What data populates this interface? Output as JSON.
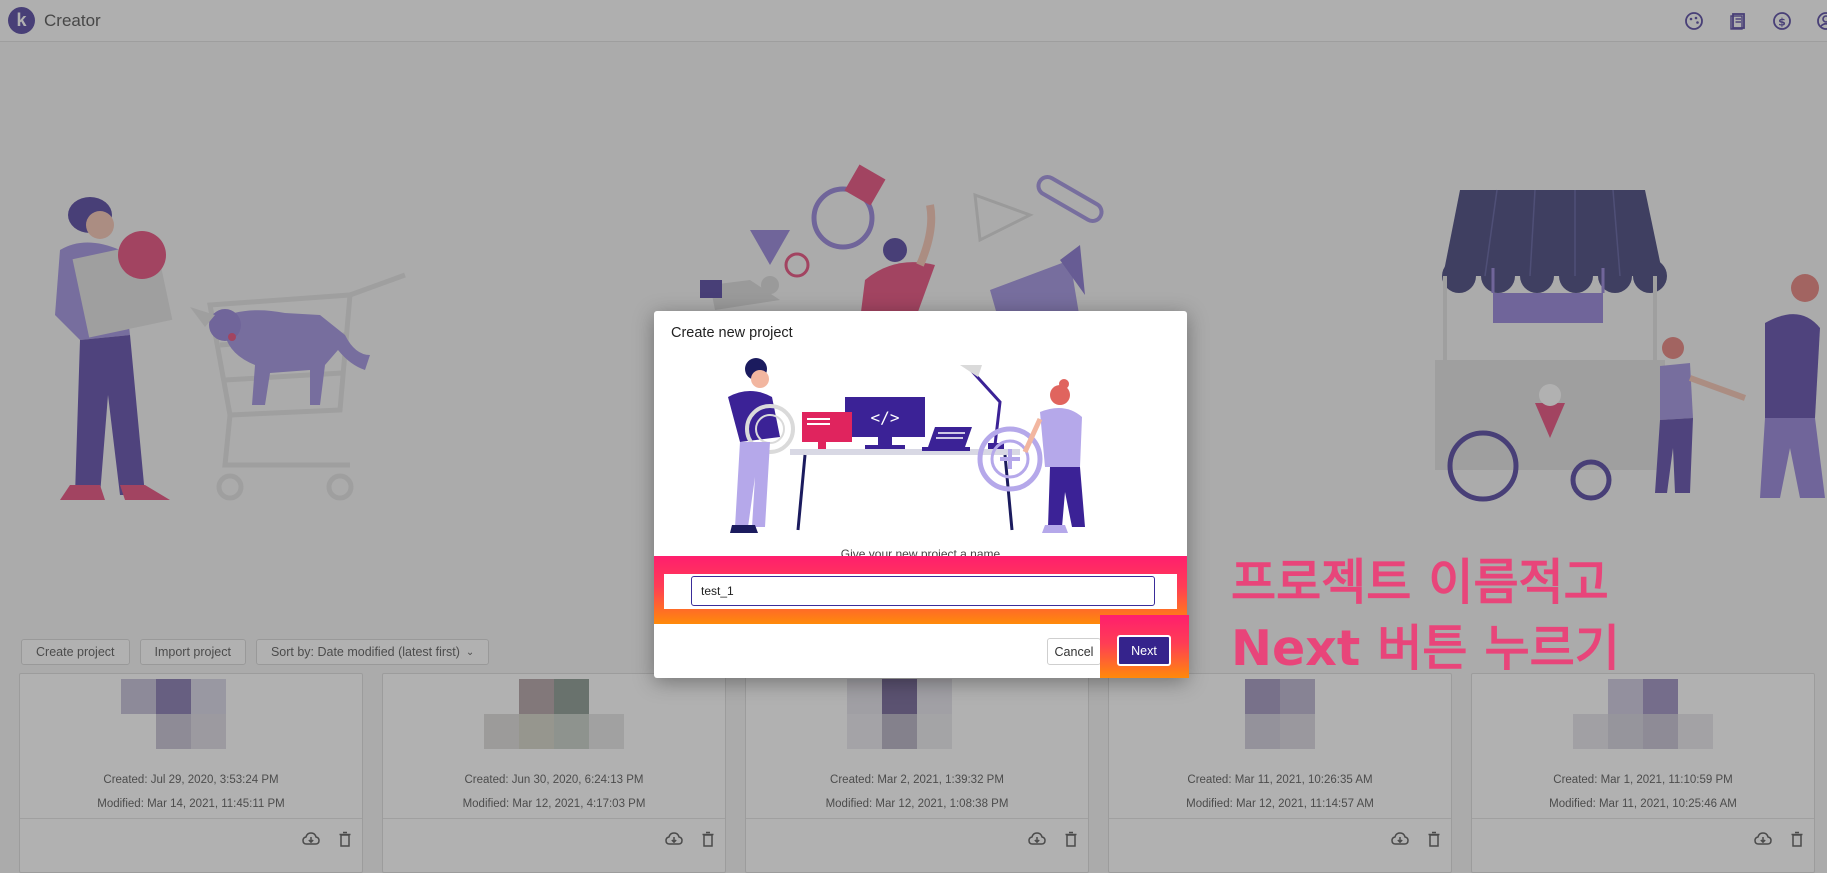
{
  "app": {
    "logo_letter": "k",
    "title": "Creator"
  },
  "header_icons": [
    "palette-icon",
    "docs-icon",
    "dollar-icon",
    "account-icon"
  ],
  "toolbar": {
    "create_label": "Create project",
    "import_label": "Import project",
    "sort_label": "Sort by: Date modified (latest first)"
  },
  "cards": [
    {
      "created": "Created: Jul 29, 2020, 3:53:24 PM",
      "modified": "Modified: Mar 14, 2021, 11:45:11 PM"
    },
    {
      "created": "Created: Jun 30, 2020, 6:24:13 PM",
      "modified": "Modified: Mar 12, 2021, 4:17:03 PM"
    },
    {
      "created": "Created: Mar 2, 2021, 1:39:32 PM",
      "modified": "Modified: Mar 12, 2021, 1:08:38 PM"
    },
    {
      "created": "Created: Mar 11, 2021, 10:26:35 AM",
      "modified": "Modified: Mar 12, 2021, 11:14:57 AM"
    },
    {
      "created": "Created: Mar 1, 2021, 11:10:59 PM",
      "modified": "Modified: Mar 11, 2021, 10:25:46 AM"
    }
  ],
  "modal": {
    "title": "Create new project",
    "hint": "Give your new project a name",
    "input_value": "test_1",
    "cancel_label": "Cancel",
    "next_label": "Next"
  },
  "annotation": {
    "line1": "프로젝트 이름적고",
    "line2": "Next 버튼 누르기"
  },
  "colors": {
    "brand": "#2d1b8a",
    "highlight_top": "#ff1e6e",
    "highlight_bottom": "#ff8a0a",
    "annotation_text": "#e8457a"
  }
}
